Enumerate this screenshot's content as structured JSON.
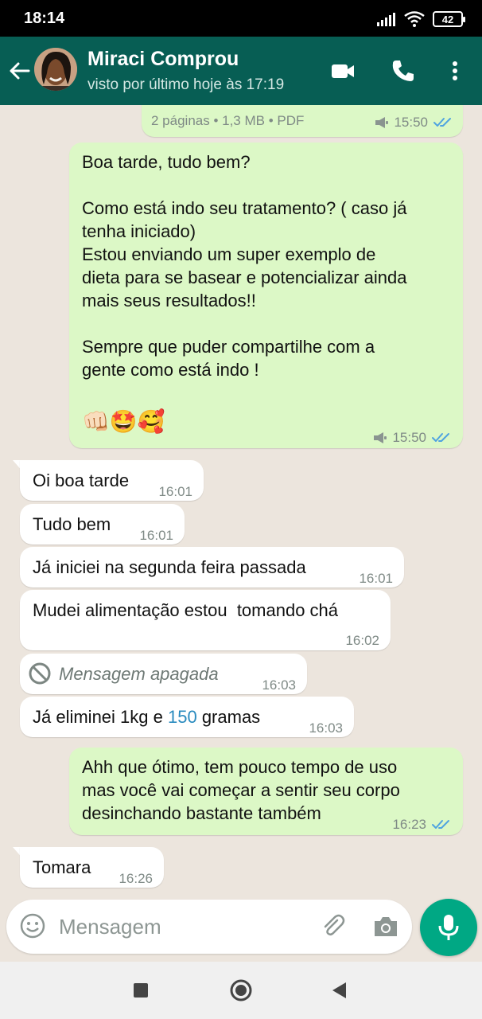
{
  "status_bar": {
    "time": "18:14",
    "battery": "42"
  },
  "header": {
    "contact_name": "Miraci Comprou",
    "last_seen": "visto por último hoje às 17:19"
  },
  "messages": [
    {
      "direction": "outgoing",
      "text": "2 páginas • 1,3 MB • PDF",
      "time": "15:50",
      "status": "read"
    },
    {
      "direction": "outgoing",
      "lines": [
        "Boa tarde, tudo bem?",
        "",
        "Como está indo seu tratamento? ( caso já",
        "tenha iniciado)",
        "Estou enviando um super exemplo de",
        "dieta para se basear e potencializar ainda",
        "mais seus resultados!!",
        "",
        "Sempre que puder compartilhe com a",
        "gente como está indo !"
      ],
      "emojis": "👊🏻🤩🥰",
      "time": "15:50",
      "status": "read"
    },
    {
      "direction": "incoming",
      "text": "Oi boa tarde",
      "time": "16:01"
    },
    {
      "direction": "incoming",
      "text": "Tudo bem",
      "time": "16:01"
    },
    {
      "direction": "incoming",
      "text": "Já iniciei na segunda feira passada",
      "time": "16:01"
    },
    {
      "direction": "incoming",
      "text": "Mudei alimentação estou  tomando chá",
      "time": "16:02"
    },
    {
      "direction": "incoming",
      "text": "Mensagem apagada",
      "time": "16:03",
      "deleted": true
    },
    {
      "direction": "incoming",
      "text_before": "Já eliminei 1kg e ",
      "number": "150",
      "text_after": " gramas",
      "time": "16:03"
    },
    {
      "direction": "outgoing",
      "lines": [
        "Ahh que ótimo, tem pouco tempo de uso",
        "mas você vai começar a sentir seu corpo",
        "desinchando bastante também"
      ],
      "time": "16:23",
      "status": "read"
    },
    {
      "direction": "incoming",
      "text": "Tomara",
      "time": "16:26"
    }
  ],
  "input": {
    "placeholder": "Mensagem"
  },
  "colors": {
    "header": "#075e54",
    "outgoing_bubble": "#dcf8c6",
    "incoming_bubble": "#ffffff",
    "chat_background": "#ece5dd",
    "mic_button": "#00a884",
    "read_ticks": "#4fa3e0"
  },
  "icons": [
    "back-arrow-icon",
    "video-call-icon",
    "phone-icon",
    "more-vert-icon",
    "speaker-icon",
    "double-tick-icon",
    "blocked-icon",
    "emoji-icon",
    "paperclip-icon",
    "camera-icon",
    "mic-icon",
    "nav-recents-icon",
    "nav-home-icon",
    "nav-back-icon"
  ]
}
